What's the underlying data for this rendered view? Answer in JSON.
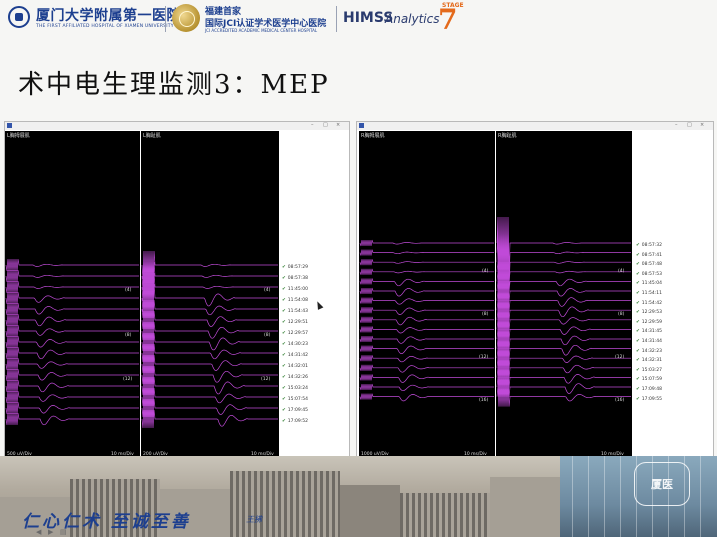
{
  "header": {
    "hospital_name_cn": "厦门大学附属第一医院",
    "hospital_name_en": "THE FIRST AFFILIATED HOSPITAL OF XIAMEN UNIVERSITY",
    "jci_line1": "福建首家",
    "jci_line2": "国际JCI认证学术医学中心医院",
    "jci_en": "JCI ACCREDITED ACADEMIC MEDICAL CENTER HOSPITAL",
    "himss": "HIMSS",
    "analytics": "Analytics",
    "stage_label": "STAGE",
    "stage_number": "7"
  },
  "slide": {
    "title": "术中电生理监测3：MEP"
  },
  "left_window": {
    "panel1_label": "L胸拇展肌",
    "panel2_label": "L胸趾肌",
    "panel1_scale": "500 uV/Div",
    "panel1_time": "10 ms/Div",
    "panel2_scale": "200 uV/Div",
    "panel2_time": "10 ms/Div",
    "channel_marks": [
      "(4)",
      "(8)",
      "(12)"
    ],
    "channel_marks_p2": [
      "(4)",
      "(8)",
      "(12)"
    ],
    "timestamps": [
      "08:57:29",
      "08:57:38",
      "11:45:00",
      "11:54:08",
      "11:54:43",
      "12:29:51",
      "12:29:57",
      "14:30:23",
      "14:31:42",
      "14:32:01",
      "14:32:26",
      "15:03:24",
      "15:07:54",
      "17:09:45",
      "17:09:52"
    ]
  },
  "right_window": {
    "panel1_label": "R胸拇展肌",
    "panel2_label": "R胸趾肌",
    "panel1_scale": "1000 uV/Div",
    "panel1_time": "10 ms/Div",
    "panel2_scale": "",
    "panel2_time": "10 ms/Div",
    "channel_marks": [
      "(4)",
      "(8)",
      "(12)",
      "(16)"
    ],
    "channel_marks_p2": [
      "(4)",
      "(8)",
      "(12)",
      "(16)"
    ],
    "timestamps": [
      "08:57:32",
      "08:57:41",
      "08:57:48",
      "08:57:53",
      "11:45:04",
      "11:54:11",
      "11:54:42",
      "12:29:53",
      "12:29:59",
      "14:31:45",
      "14:31:44",
      "14:32:23",
      "14:32:31",
      "15:03:27",
      "15:07:59",
      "17:09:48",
      "17:09:55"
    ]
  },
  "footer": {
    "motto": "仁心仁术 至诚至善",
    "signature": "王拂",
    "watermark": "厦医"
  },
  "colors": {
    "trace": "#c04bd8",
    "trace_bright": "#e45ff0",
    "plot_bg": "#000000",
    "brand_blue": "#1d3f8f",
    "stage_orange": "#e46a1b"
  }
}
